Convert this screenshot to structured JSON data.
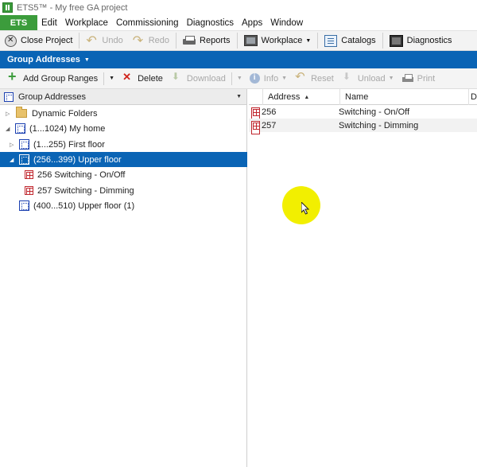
{
  "window": {
    "title": "ETS5™ - My free GA project"
  },
  "menubar": {
    "ets_label": "ETS",
    "items": [
      "Edit",
      "Workplace",
      "Commissioning",
      "Diagnostics",
      "Apps",
      "Window"
    ]
  },
  "toolbar": {
    "close_project": "Close Project",
    "undo": "Undo",
    "redo": "Redo",
    "reports": "Reports",
    "workplace": "Workplace",
    "catalogs": "Catalogs",
    "diagnostics": "Diagnostics"
  },
  "panel": {
    "title": "Group Addresses"
  },
  "actions": {
    "add_group_ranges": "Add Group Ranges",
    "delete": "Delete",
    "download": "Download",
    "info": "Info",
    "reset": "Reset",
    "unload": "Unload",
    "print": "Print"
  },
  "tree": {
    "header": "Group Addresses",
    "items": [
      {
        "label": "Dynamic Folders",
        "icon": "folder-icon"
      },
      {
        "label": "(1...1024) My home",
        "icon": "group-range-icon"
      },
      {
        "label": "(1...255) First floor",
        "icon": "group-range-icon"
      },
      {
        "label": "(256...399) Upper floor",
        "icon": "group-range-icon",
        "selected": true
      },
      {
        "label": "256 Switching - On/Off",
        "icon": "group-address-icon"
      },
      {
        "label": "257 Switching - Dimming",
        "icon": "group-address-icon"
      },
      {
        "label": "(400...510) Upper floor (1)",
        "icon": "group-range-icon"
      }
    ]
  },
  "grid": {
    "columns": [
      "Address",
      "Name",
      "D"
    ],
    "rows": [
      {
        "address": "256",
        "name": "Switching - On/Off"
      },
      {
        "address": "257",
        "name": "Switching - Dimming"
      }
    ]
  },
  "colors": {
    "accent_blue": "#0a64b5",
    "ets_green": "#3c9c3c",
    "cursor_highlight": "#f2ef00"
  }
}
